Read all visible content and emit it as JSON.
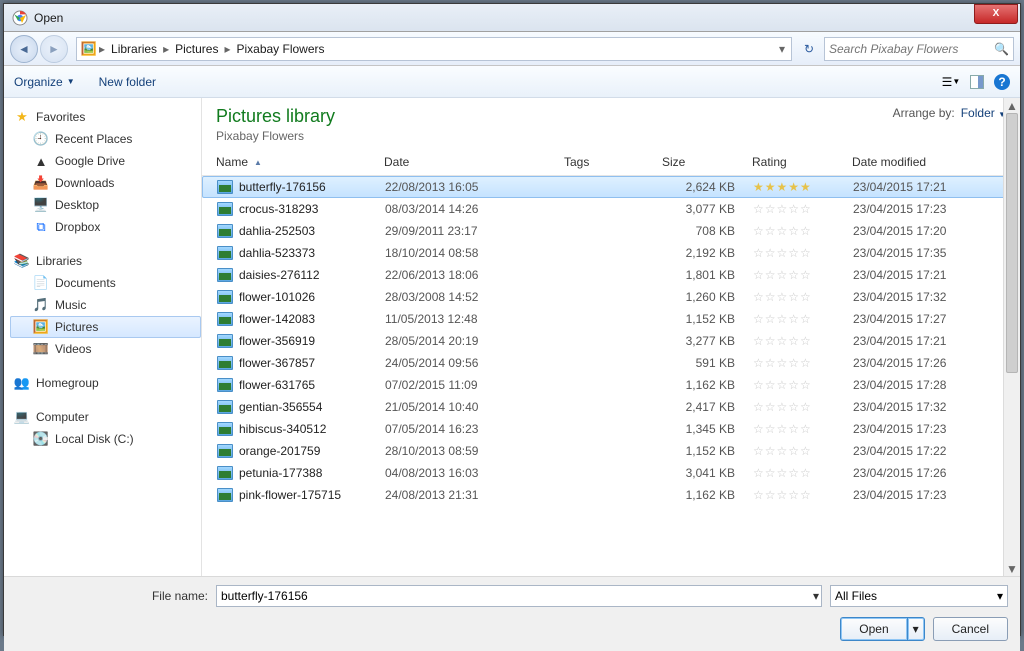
{
  "window": {
    "title": "Open",
    "close": "X"
  },
  "nav": {
    "segments": [
      "Libraries",
      "Pictures",
      "Pixabay Flowers"
    ],
    "search_placeholder": "Search Pixabay Flowers"
  },
  "toolbar": {
    "organize": "Organize",
    "new_folder": "New folder"
  },
  "sidebar": {
    "favorites_label": "Favorites",
    "favorites": [
      "Recent Places",
      "Google Drive",
      "Downloads",
      "Desktop",
      "Dropbox"
    ],
    "libraries_label": "Libraries",
    "libraries": [
      "Documents",
      "Music",
      "Pictures",
      "Videos"
    ],
    "homegroup": "Homegroup",
    "computer": "Computer",
    "local_disk": "Local Disk (C:)"
  },
  "library": {
    "title": "Pictures library",
    "subtitle": "Pixabay Flowers",
    "arrange_label": "Arrange by:",
    "arrange_value": "Folder"
  },
  "columns": {
    "name": "Name",
    "date": "Date",
    "tags": "Tags",
    "size": "Size",
    "rating": "Rating",
    "modified": "Date modified"
  },
  "files": [
    {
      "name": "butterfly-176156",
      "date": "22/08/2013 16:05",
      "size": "2,624 KB",
      "rating": 5,
      "modified": "23/04/2015 17:21",
      "selected": true
    },
    {
      "name": "crocus-318293",
      "date": "08/03/2014 14:26",
      "size": "3,077 KB",
      "rating": 0,
      "modified": "23/04/2015 17:23"
    },
    {
      "name": "dahlia-252503",
      "date": "29/09/2011 23:17",
      "size": "708 KB",
      "rating": 0,
      "modified": "23/04/2015 17:20"
    },
    {
      "name": "dahlia-523373",
      "date": "18/10/2014 08:58",
      "size": "2,192 KB",
      "rating": 0,
      "modified": "23/04/2015 17:35"
    },
    {
      "name": "daisies-276112",
      "date": "22/06/2013 18:06",
      "size": "1,801 KB",
      "rating": 0,
      "modified": "23/04/2015 17:21"
    },
    {
      "name": "flower-101026",
      "date": "28/03/2008 14:52",
      "size": "1,260 KB",
      "rating": 0,
      "modified": "23/04/2015 17:32"
    },
    {
      "name": "flower-142083",
      "date": "11/05/2013 12:48",
      "size": "1,152 KB",
      "rating": 0,
      "modified": "23/04/2015 17:27"
    },
    {
      "name": "flower-356919",
      "date": "28/05/2014 20:19",
      "size": "3,277 KB",
      "rating": 0,
      "modified": "23/04/2015 17:21"
    },
    {
      "name": "flower-367857",
      "date": "24/05/2014 09:56",
      "size": "591 KB",
      "rating": 0,
      "modified": "23/04/2015 17:26"
    },
    {
      "name": "flower-631765",
      "date": "07/02/2015 11:09",
      "size": "1,162 KB",
      "rating": 0,
      "modified": "23/04/2015 17:28"
    },
    {
      "name": "gentian-356554",
      "date": "21/05/2014 10:40",
      "size": "2,417 KB",
      "rating": 0,
      "modified": "23/04/2015 17:32"
    },
    {
      "name": "hibiscus-340512",
      "date": "07/05/2014 16:23",
      "size": "1,345 KB",
      "rating": 0,
      "modified": "23/04/2015 17:23"
    },
    {
      "name": "orange-201759",
      "date": "28/10/2013 08:59",
      "size": "1,152 KB",
      "rating": 0,
      "modified": "23/04/2015 17:22"
    },
    {
      "name": "petunia-177388",
      "date": "04/08/2013 16:03",
      "size": "3,041 KB",
      "rating": 0,
      "modified": "23/04/2015 17:26"
    },
    {
      "name": "pink-flower-175715",
      "date": "24/08/2013 21:31",
      "size": "1,162 KB",
      "rating": 0,
      "modified": "23/04/2015 17:23"
    }
  ],
  "footer": {
    "filename_label": "File name:",
    "filename_value": "butterfly-176156",
    "filter": "All Files",
    "open": "Open",
    "cancel": "Cancel"
  }
}
